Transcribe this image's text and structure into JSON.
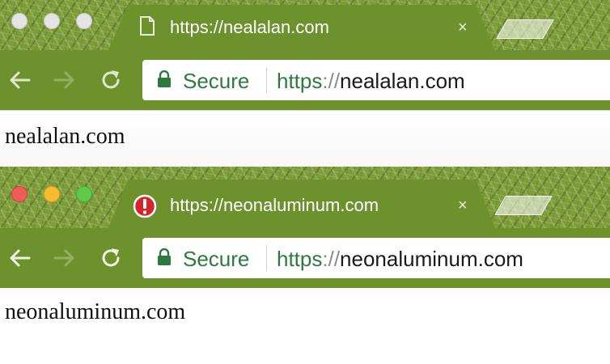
{
  "windows": [
    {
      "tab": {
        "title": "https://nealalan.com",
        "favicon": "page-icon",
        "close_icon": "×"
      },
      "toolbar": {
        "back_icon": "back-arrow-icon",
        "forward_icon": "forward-arrow-icon",
        "reload_icon": "reload-icon",
        "security_label": "Secure",
        "url_scheme": "https",
        "url_separator": "://",
        "url_host": "nealalan.com"
      },
      "content": {
        "text": "nealalan.com"
      },
      "traffic_lights": "inactive-gray"
    },
    {
      "tab": {
        "title": "https://neonaluminum.com",
        "favicon": "error-icon",
        "close_icon": "×"
      },
      "toolbar": {
        "back_icon": "back-arrow-icon",
        "forward_icon": "forward-arrow-icon",
        "reload_icon": "reload-icon",
        "security_label": "Secure",
        "url_scheme": "https",
        "url_separator": "://",
        "url_host": "neonaluminum.com"
      },
      "content": {
        "text": "neonaluminum.com"
      },
      "traffic_lights": "active-colored"
    }
  ],
  "colors": {
    "toolbar": "#6d922d",
    "secure_green": "#2d7a3e",
    "traffic_red": "#ee5d57",
    "traffic_yellow": "#f5bc2f",
    "traffic_green": "#60c84a",
    "error_red": "#d8232a"
  }
}
